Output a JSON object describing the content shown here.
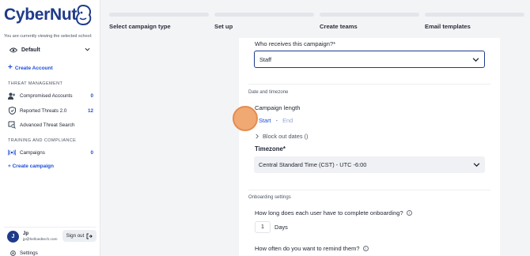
{
  "app": {
    "brand": "CyberNut"
  },
  "sidebar": {
    "viewing_text": "You are currently viewing the selected school:",
    "school_selected": "Default",
    "create_account": "Create Account",
    "threat_section": "THREAT MANAGEMENT",
    "threat_items": [
      {
        "label": "Compromised Accounts",
        "count": "0",
        "icon": "users-icon"
      },
      {
        "label": "Reported Threats 2.0",
        "count": "12",
        "icon": "shield-icon"
      },
      {
        "label": "Advanced Threat Search",
        "count": "",
        "icon": "search-shield-icon"
      }
    ],
    "training_section": "TRAINING AND COMPLIANCE",
    "training_items": [
      {
        "label": "Campaigns",
        "count": "0",
        "icon": "broadcast-icon"
      }
    ],
    "create_campaign": "+ Create campaign",
    "user": {
      "initial": "J",
      "name": "Jp",
      "email": "jp@helloedtech.com"
    },
    "sign_out": "Sign out",
    "settings": "Settings"
  },
  "stepper": [
    {
      "label": "Select campaign type"
    },
    {
      "label": "Set up"
    },
    {
      "label": "Create teams"
    },
    {
      "label": "Email templates"
    }
  ],
  "form": {
    "who_receives_label": "Who receives this campaign?*",
    "who_receives_value": "Staff",
    "date_section": "Date and timezone",
    "campaign_length_label": "Campaign length",
    "start_placeholder": "Start",
    "date_separator": "-",
    "end_placeholder": "End",
    "block_out": "Block out dates ()",
    "timezone_label": "Timezone*",
    "timezone_value": "Central Standard Time (CST) - UTC -6:00",
    "onboarding_section": "Onboarding settings",
    "onboarding_question": "How long does each user have to complete onboarding?",
    "onboarding_days_value": "1",
    "days_unit": "Days",
    "remind_question": "How often do you want to remind them?"
  },
  "colors": {
    "accent": "#1d4ed8",
    "brand": "#1e3a8a",
    "click_indicator": "#f0a56b"
  }
}
